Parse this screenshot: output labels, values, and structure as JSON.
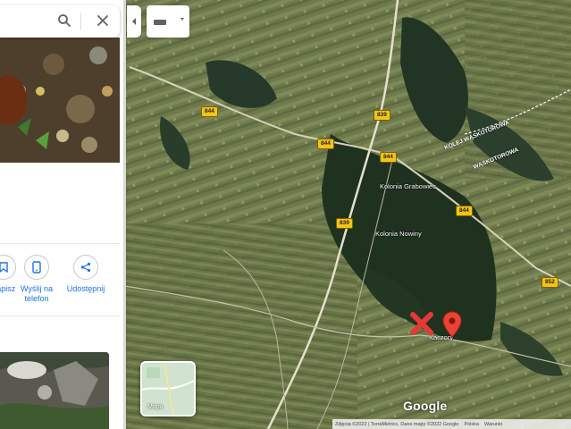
{
  "search": {
    "value": "",
    "placeholder": ""
  },
  "actions": [
    {
      "label": "Zapisz"
    },
    {
      "label": "Wyślij na telefon"
    },
    {
      "label": "Udostępnij"
    }
  ],
  "map": {
    "places": [
      "Kolonia Grabowiec",
      "Kolonia Nowiny",
      "Kaczory"
    ],
    "roads": [
      "844",
      "839",
      "844",
      "844",
      "839",
      "844",
      "852"
    ],
    "railway_labels": [
      "KOLEJ WĄSKOTOROWA",
      "WĄSKOTOROWA"
    ],
    "marker_color": "#ea4335",
    "x_marker_color": "#e53935"
  },
  "layers": {
    "label": "Mapa"
  },
  "branding": {
    "google": "Google"
  },
  "footer": {
    "imagery": "Zdjęcia ©2022 | TerraMetrics, Dane mapy ©2022 Google",
    "country": "Polska",
    "terms": "Warunki"
  }
}
